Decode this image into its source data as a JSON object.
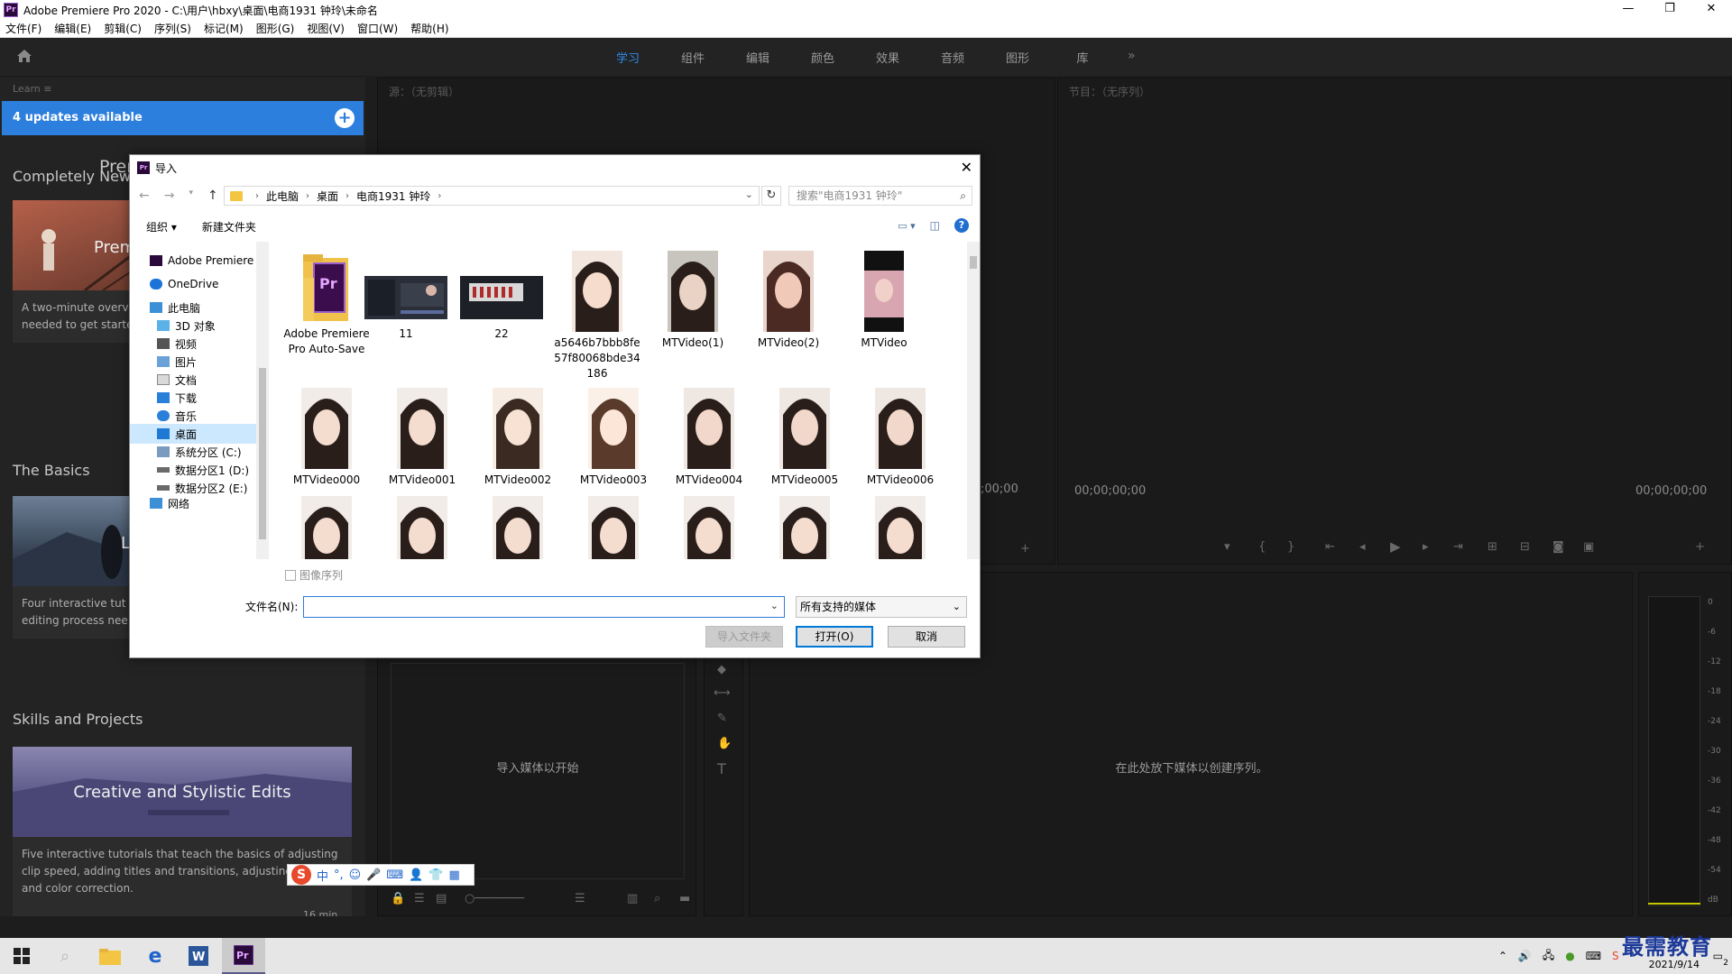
{
  "window": {
    "title": "Adobe Premiere Pro 2020 - C:\\用户\\hbxy\\桌面\\电商1931 钟玲\\未命名",
    "logo": "Pr",
    "minimize": "—",
    "restore": "❐",
    "close": "✕"
  },
  "menu": [
    "文件(F)",
    "编辑(E)",
    "剪辑(C)",
    "序列(S)",
    "标记(M)",
    "图形(G)",
    "视图(V)",
    "窗口(W)",
    "帮助(H)"
  ],
  "workspace": {
    "tabs": [
      "学习",
      "组件",
      "编辑",
      "颜色",
      "效果",
      "音频",
      "图形",
      "库"
    ],
    "active": "学习",
    "more": "»",
    "menu_icon": "≡"
  },
  "learn": {
    "header": "Learn",
    "updates": "4 updates available",
    "pre_label": "Prer",
    "sections": [
      {
        "title": "Completely New",
        "thumb_text": "Prem",
        "desc": "A two-minute overv\nneeded to get starte"
      },
      {
        "title": "The Basics",
        "thumb_text": "L",
        "desc": "Four interactive tut\nediting process nee"
      },
      {
        "title": "Skills and Projects",
        "thumb_text": "Creative and Stylistic Edits",
        "desc": "Five interactive tutorials that teach the basics of adjusting clip speed, adding titles and transitions, adjusting audio, and color correction.",
        "duration": "16 min"
      }
    ]
  },
  "source_panel": {
    "header": "源：（无剪辑）",
    "timecode": ";00;00"
  },
  "program_panel": {
    "header": "节目：（无序列）",
    "timecode_left": "00;00;00;00",
    "timecode_right": "00;00;00;00"
  },
  "project_panel": {
    "hint": "导入媒体以开始"
  },
  "timeline_panel": {
    "hint": "在此处放下媒体以创建序列。"
  },
  "meter": {
    "scale": [
      "0",
      "-6",
      "-12",
      "-18",
      "-24",
      "-30",
      "-36",
      "-42",
      "-48",
      "-54",
      "dB"
    ]
  },
  "dialog": {
    "title": "导入",
    "logo": "Pr",
    "close": "✕",
    "path": [
      "此电脑",
      "桌面",
      "电商1931 钟玲"
    ],
    "search_placeholder": "搜索\"电商1931 钟玲\"",
    "organize": "组织 ▾",
    "new_folder": "新建文件夹",
    "help": "?",
    "tree": [
      {
        "label": "Adobe Premiere",
        "icon": "premiere-icon"
      },
      {
        "label": "OneDrive",
        "icon": "onedrive-icon"
      },
      {
        "label": "此电脑",
        "icon": "computer-icon"
      },
      {
        "label": "3D 对象",
        "icon": "3d-objects-icon"
      },
      {
        "label": "视频",
        "icon": "videos-icon"
      },
      {
        "label": "图片",
        "icon": "pictures-icon"
      },
      {
        "label": "文档",
        "icon": "documents-icon"
      },
      {
        "label": "下载",
        "icon": "downloads-icon"
      },
      {
        "label": "音乐",
        "icon": "music-icon"
      },
      {
        "label": "桌面",
        "icon": "desktop-icon"
      },
      {
        "label": "系统分区 (C:)",
        "icon": "drive-c-icon"
      },
      {
        "label": "数据分区1 (D:)",
        "icon": "drive-icon"
      },
      {
        "label": "数据分区2 (E:)",
        "icon": "drive-icon"
      },
      {
        "label": "网络",
        "icon": "network-icon"
      }
    ],
    "selected_tree": "桌面",
    "files_row1": [
      "Adobe Premiere Pro Auto-Save",
      "11",
      "22",
      "a5646b7bbb8fe57f80068bde34186",
      "MTVideo(1)",
      "MTVideo(2)",
      "MTVideo"
    ],
    "files_row2": [
      "MTVideo000",
      "MTVideo001",
      "MTVideo002",
      "MTVideo003",
      "MTVideo004",
      "MTVideo005",
      "MTVideo006"
    ],
    "image_sequence": "图像序列",
    "filename_label": "文件名(N):",
    "filename_value": "",
    "type_value": "所有支持的媒体",
    "import_folder": "导入文件夹",
    "open": "打开(O)",
    "cancel": "取消"
  },
  "ime": {
    "logo": "S",
    "items": [
      "中",
      "°,",
      "☺",
      "🎤",
      "⌨",
      "👤",
      "👕",
      "▦"
    ]
  },
  "taskbar": {
    "date": "2021/9/14",
    "tray_badge": "2",
    "watermark": "最需教育"
  }
}
